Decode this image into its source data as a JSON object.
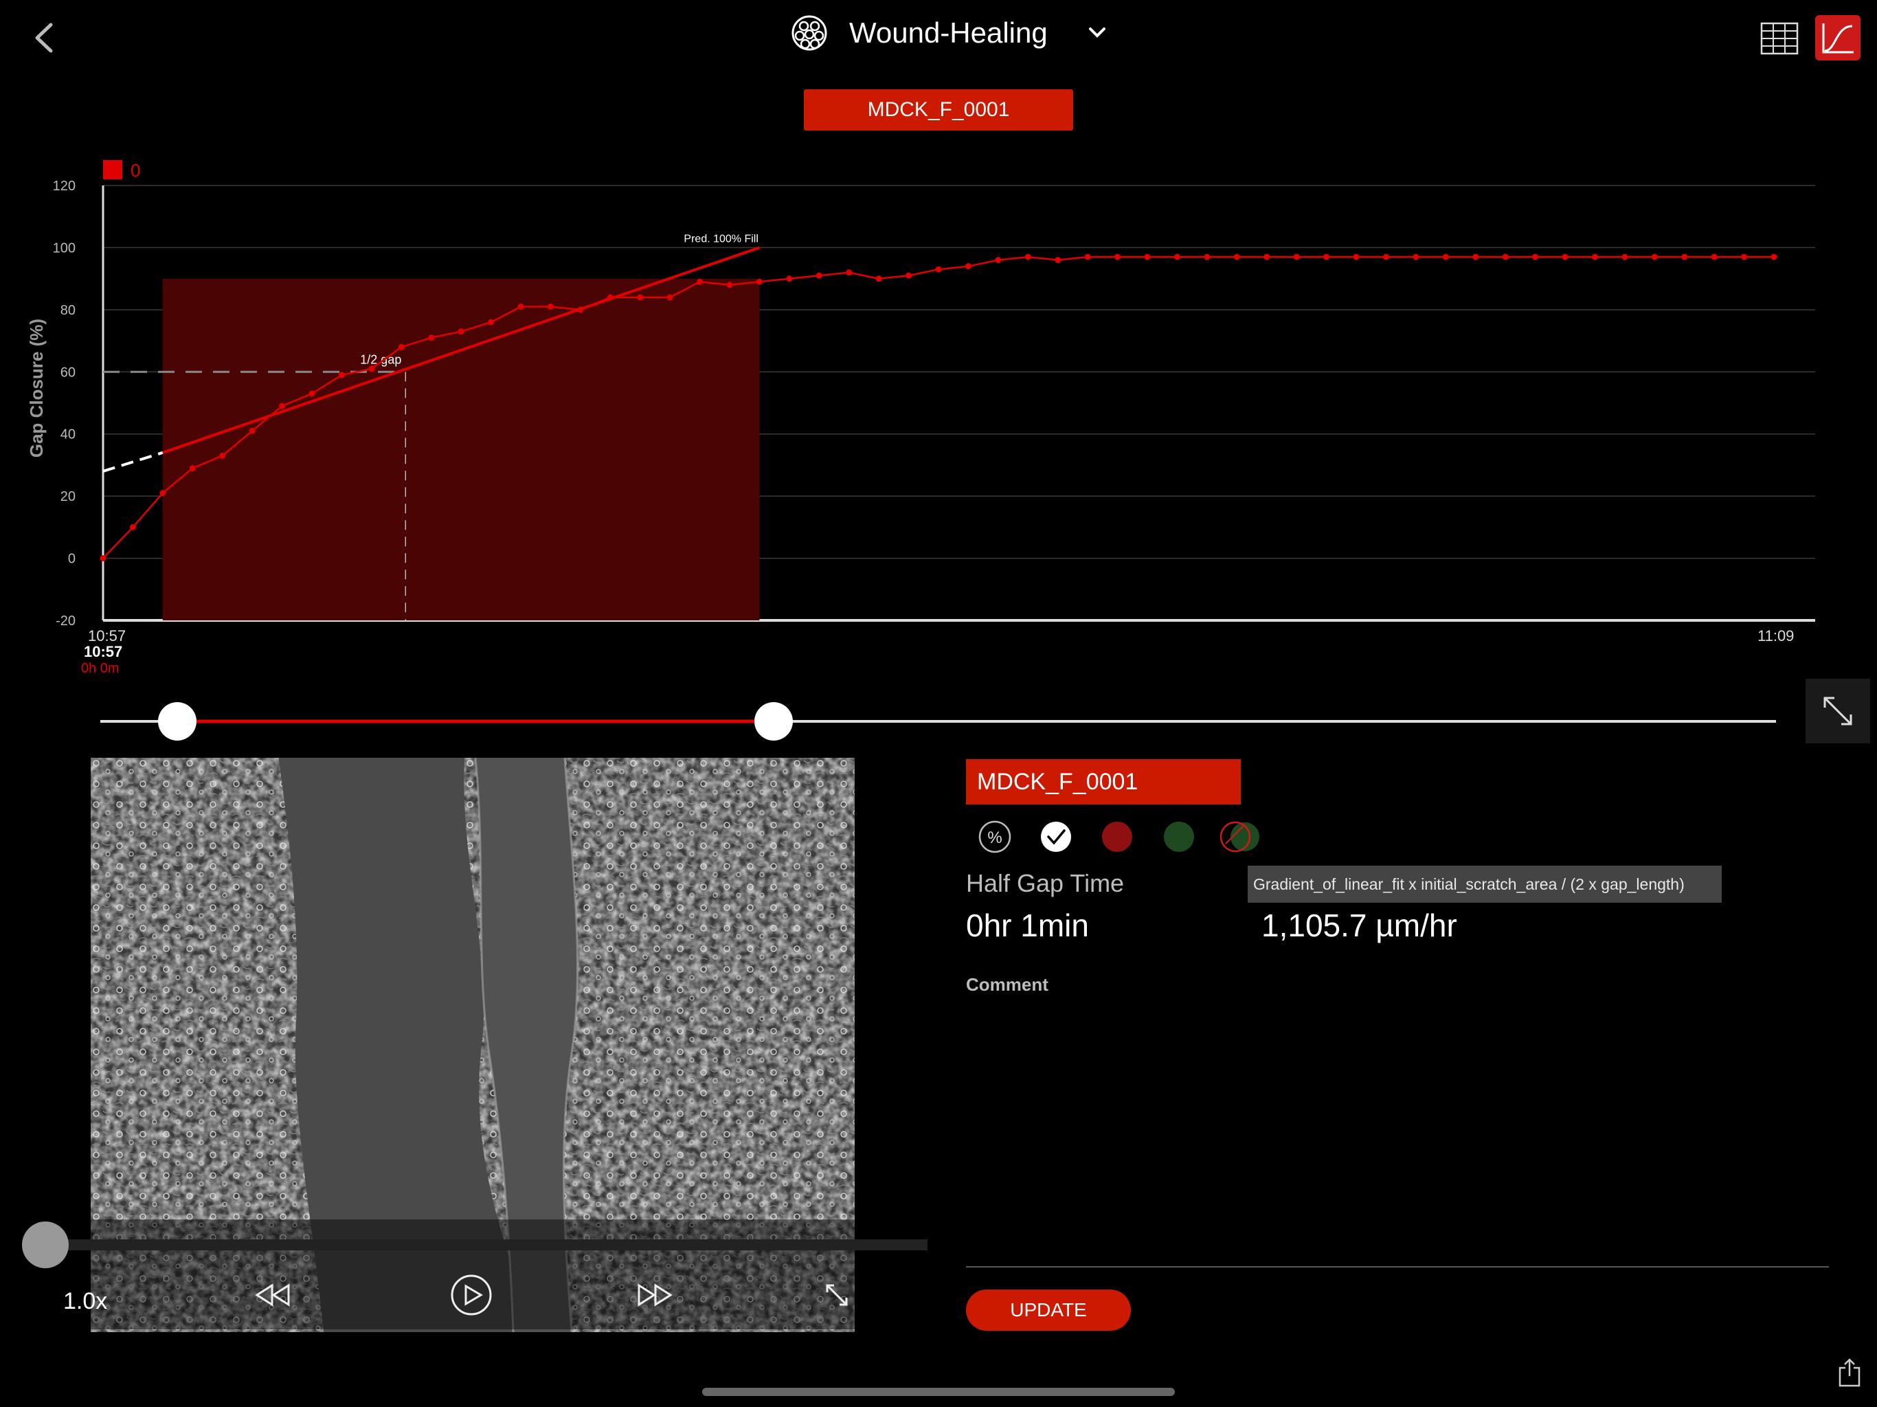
{
  "header": {
    "title": "Wound-Healing",
    "well_tag": "MDCK_F_0001"
  },
  "colors": {
    "accent": "#cc1a00",
    "fill": "#4a0404",
    "line": "#e00000"
  },
  "chart_data": {
    "type": "line",
    "ylabel": "Gap Closure (%)",
    "ylim": [
      -20,
      120
    ],
    "yticks": [
      120,
      100,
      80,
      60,
      40,
      20,
      0,
      -20
    ],
    "legend": "0",
    "x_start_label": "10:57",
    "x_end_label": "11:09",
    "cursor_time": "10:57",
    "cursor_elapsed": "0h 0m",
    "half_gap_label": "1/2 gap",
    "pred_label": "Pred. 100% Fill",
    "half_gap_level": 60,
    "fit_line": {
      "start_index": 2,
      "start_value": 34,
      "end_index": 22,
      "end_value": 100
    },
    "fit_extension": {
      "start_value": 28
    },
    "half_gap_index": 10,
    "selection": {
      "start_index": 2,
      "end_index": 22
    },
    "series": [
      {
        "values": [
          0,
          10,
          21,
          29,
          33,
          41,
          49,
          53,
          59,
          61,
          68,
          71,
          73,
          76,
          81,
          81,
          80,
          84,
          84,
          84,
          89,
          88,
          89,
          90,
          91,
          92,
          90,
          91,
          93,
          94,
          96,
          97,
          96,
          97,
          97,
          97,
          97,
          97,
          97,
          97,
          97,
          97,
          97,
          97,
          97,
          97,
          97,
          97,
          97,
          97,
          97,
          97,
          97,
          97,
          97,
          97,
          97
        ]
      }
    ]
  },
  "playback": {
    "speed": "1.0x"
  },
  "info": {
    "tag": "MDCK_F_0001",
    "half_gap_label": "Half Gap Time",
    "half_gap_value": "0hr 1min",
    "formula": "Gradient_of_linear_fit x initial_scratch_area / (2 x gap_length)",
    "rate_value": "1,105.7 µm/hr",
    "comment_label": "Comment",
    "update_label": "UPDATE",
    "percent_symbol": "%"
  }
}
